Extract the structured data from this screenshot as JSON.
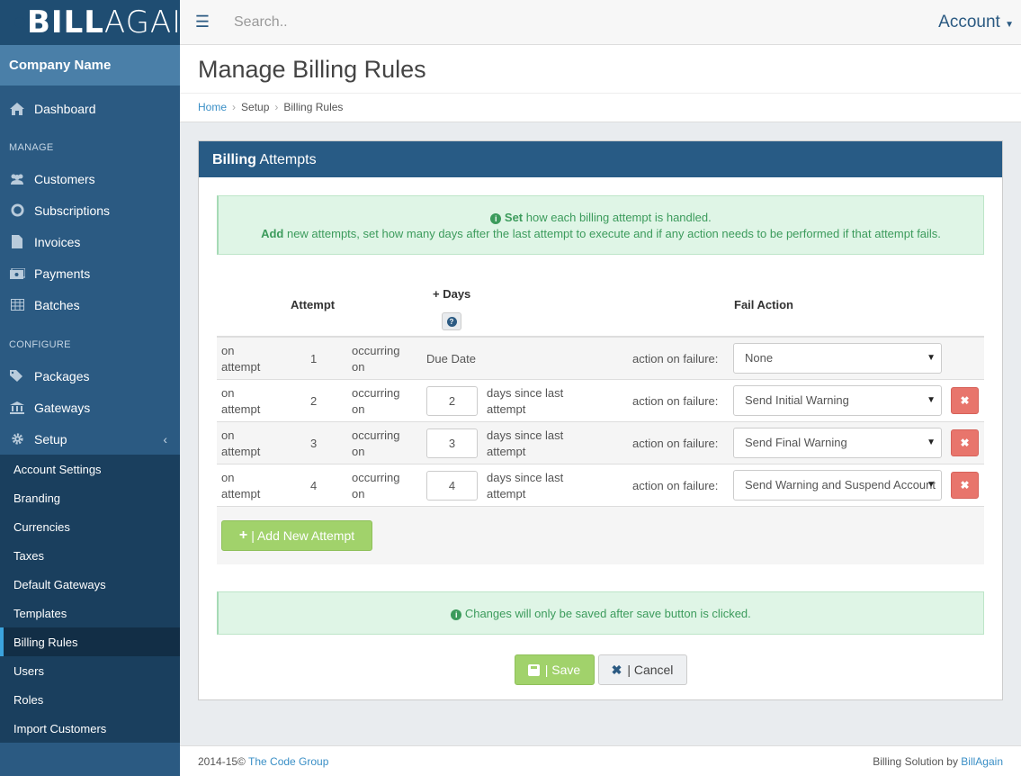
{
  "brand": {
    "logo_bold": "BILL",
    "logo_light": "AGAIN",
    "company": "Company Name"
  },
  "topbar": {
    "search_placeholder": "Search..",
    "account_label": "Account"
  },
  "sidebar": {
    "dashboard": "Dashboard",
    "manage_heading": "MANAGE",
    "manage_items": [
      "Customers",
      "Subscriptions",
      "Invoices",
      "Payments",
      "Batches"
    ],
    "configure_heading": "CONFIGURE",
    "configure_items": [
      "Packages",
      "Gateways",
      "Setup"
    ],
    "setup_subitems": [
      "Account Settings",
      "Branding",
      "Currencies",
      "Taxes",
      "Default Gateways",
      "Templates",
      "Billing Rules",
      "Users",
      "Roles",
      "Import Customers"
    ],
    "active_subitem": "Billing Rules"
  },
  "page": {
    "title": "Manage Billing Rules",
    "breadcrumb": [
      "Home",
      "Setup",
      "Billing Rules"
    ]
  },
  "panel": {
    "title_bold": "Billing",
    "title_rest": " Attempts",
    "alert_line1_bold": "Set",
    "alert_line1_rest": " how each billing attempt is handled.",
    "alert_line2_bold": "Add",
    "alert_line2_rest": " new attempts, set how many days after the last attempt to execute and if any action needs to be performed if that attempt fails.",
    "headers": {
      "attempt": "Attempt",
      "days": "+ Days",
      "fail_action": "Fail Action"
    },
    "row_label_on": "on attempt",
    "row_label_occurring": "occurring on",
    "row_label_days": "days since last attempt",
    "row_label_action": "action on failure:",
    "rows": [
      {
        "attempt": "1",
        "days": "Due Date",
        "action": "None"
      },
      {
        "attempt": "2",
        "days": "2",
        "action": "Send Initial Warning"
      },
      {
        "attempt": "3",
        "days": "3",
        "action": "Send Final Warning"
      },
      {
        "attempt": "4",
        "days": "4",
        "action": "Send Warning and Suspend Account"
      }
    ],
    "add_button": "| Add New Attempt",
    "save_note": " Changes will only be saved after save button is clicked.",
    "save_button": "| Save",
    "cancel_button": "| Cancel"
  },
  "footer": {
    "copyright": "2014-15©",
    "company_link": "The Code Group",
    "right_text": "Billing Solution by",
    "right_link": "BillAgain"
  },
  "colors": {
    "sidebar": "#2b5a82",
    "panel_header": "#285b85",
    "success": "#a1d26b",
    "danger": "#e8756c",
    "alert_bg": "#dff5e6"
  }
}
